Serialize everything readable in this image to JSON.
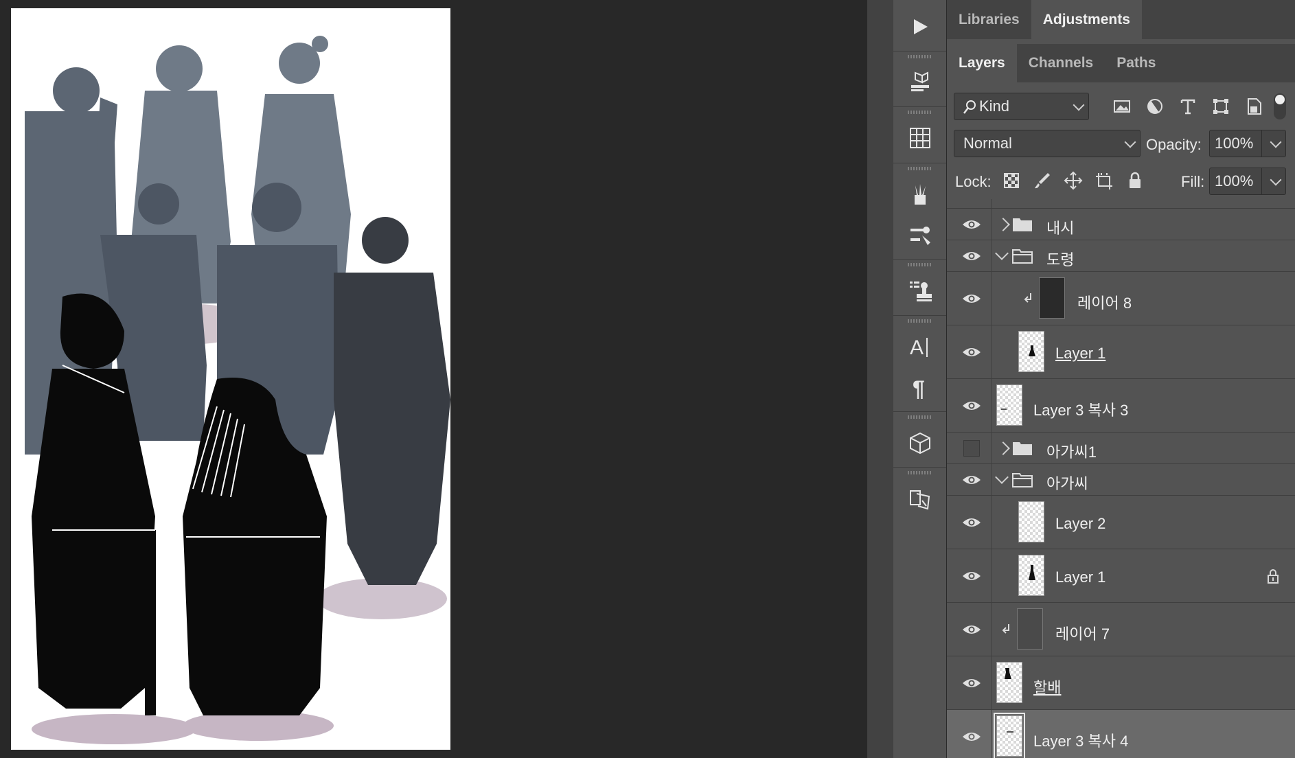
{
  "panel": {
    "top_tabs": [
      {
        "label": "Libraries",
        "active": false
      },
      {
        "label": "Adjustments",
        "active": true
      }
    ],
    "layer_tabs": [
      {
        "label": "Layers",
        "active": true
      },
      {
        "label": "Channels",
        "active": false
      },
      {
        "label": "Paths",
        "active": false
      }
    ],
    "filter": {
      "kind_label": "Kind"
    },
    "blend_mode": "Normal",
    "opacity_label": "Opacity:",
    "opacity_value": "100%",
    "lock_label": "Lock:",
    "fill_label": "Fill:",
    "fill_value": "100%"
  },
  "layers": [
    {
      "name": "내시",
      "type": "group",
      "visible": true,
      "expanded": false,
      "indent": 0
    },
    {
      "name": "도령",
      "type": "group",
      "visible": true,
      "expanded": true,
      "indent": 0
    },
    {
      "name": "레이어 8",
      "type": "layer",
      "visible": true,
      "clipped": true,
      "thumb": "dark",
      "indent": 1
    },
    {
      "name": "Layer 1",
      "type": "layer",
      "visible": true,
      "underline": true,
      "indent": 1
    },
    {
      "name": "Layer 3 복사 3",
      "type": "layer",
      "visible": true,
      "indent": 0
    },
    {
      "name": "아가씨1",
      "type": "group",
      "visible": false,
      "expanded": false,
      "indent": 0
    },
    {
      "name": "아가씨",
      "type": "group",
      "visible": true,
      "expanded": true,
      "indent": 0
    },
    {
      "name": "Layer 2",
      "type": "layer",
      "visible": true,
      "indent": 1
    },
    {
      "name": "Layer 1",
      "type": "layer",
      "visible": true,
      "locked": true,
      "indent": 1
    },
    {
      "name": "레이어 7",
      "type": "layer",
      "visible": true,
      "clipped": true,
      "indent": 0
    },
    {
      "name": "할배",
      "type": "layer",
      "visible": true,
      "underline": true,
      "indent": 0
    },
    {
      "name": "Layer 3 복사 4",
      "type": "layer",
      "visible": true,
      "selected": true,
      "indent": 0
    }
  ],
  "colors": {
    "panel_bg": "#535353",
    "tab_bar_bg": "#434343",
    "canvas_bg": "#282828",
    "selected_row": "#6a6a6a"
  }
}
